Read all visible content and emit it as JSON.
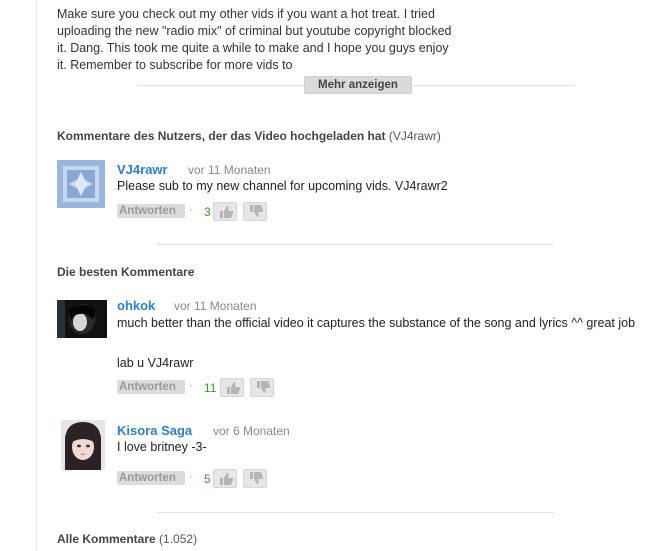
{
  "description": {
    "text": "Make sure you check out my other vids if you want a hot treat. I tried uploading the new \"radio mix\" of criminal but youtube copyright blocked it. Dang. This took me quite a while to make and I hope you guys enjoy it. Remember to subscribe for more vids to",
    "show_more_label": "Mehr anzeigen"
  },
  "uploader_section": {
    "heading": "Kommentare des Nutzers, der das Video hochgeladen hat",
    "heading_user": "(VJ4rawr)",
    "comment": {
      "author": "VJ4rawr",
      "age": "vor 11 Monaten",
      "text": "Please sub to my new channel for upcoming vids. VJ4rawr2",
      "reply_label": "Antworten",
      "separator": "·",
      "votes": "3"
    }
  },
  "top_section": {
    "heading": "Die besten Kommentare",
    "comments": [
      {
        "author": "ohkok",
        "age": "vor 11 Monaten",
        "text": "much better than the official video it captures the substance of the song and lyrics ^^ great job",
        "text2": "lab u  VJ4rawr",
        "reply_label": "Antworten",
        "separator": "·",
        "votes": "11"
      },
      {
        "author": "Kisora Saga",
        "age": "vor 6 Monaten",
        "text": "I love britney -3-",
        "reply_label": "Antworten",
        "separator": "·",
        "votes": "5"
      }
    ]
  },
  "all_section": {
    "heading": "Alle Kommentare",
    "count": "(1.052)"
  },
  "icons": {
    "like": "thumbs-up-icon",
    "dislike": "thumbs-down-icon"
  },
  "colors": {
    "author_link": "#2a7fd4",
    "vote_count": "#2e9e2e"
  }
}
